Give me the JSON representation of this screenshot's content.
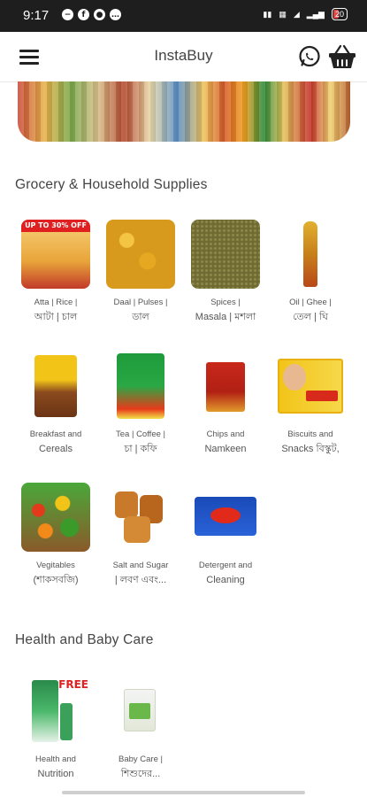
{
  "status": {
    "time": "9:17",
    "battery": "20"
  },
  "header": {
    "title": "InstaBuy"
  },
  "sections": [
    {
      "title": "Grocery & Household Supplies"
    },
    {
      "title": "Health and Baby Care"
    }
  ],
  "grocery": [
    {
      "line1": "Atta | Rice |",
      "line2": "আটা | চাল",
      "badge": "UP TO 30% OFF"
    },
    {
      "line1": "Daal | Pulses |",
      "line2": "ডাল"
    },
    {
      "line1": "Spices |",
      "line2": "Masala | মশলা"
    },
    {
      "line1": "Oil | Ghee |",
      "line2": "তেল | ঘি"
    },
    {
      "line1": "Breakfast and",
      "line2": "Cereals"
    },
    {
      "line1": "Tea | Coffee |",
      "line2": "চা | কফি"
    },
    {
      "line1": "Chips and",
      "line2": "Namkeen"
    },
    {
      "line1": "Biscuits and",
      "line2": "Snacks বিস্কুট,"
    },
    {
      "line1": "Vegitables",
      "line2": "(শাকসবজি)"
    },
    {
      "line1": "Salt and Sugar",
      "line2": "| লবণ এবং..."
    },
    {
      "line1": "Detergent and",
      "line2": "Cleaning"
    }
  ],
  "health": [
    {
      "line1": "Health and",
      "line2": "Nutrition",
      "badge": "FREE"
    },
    {
      "line1": "Baby Care |",
      "line2": "শিশুদের..."
    }
  ]
}
